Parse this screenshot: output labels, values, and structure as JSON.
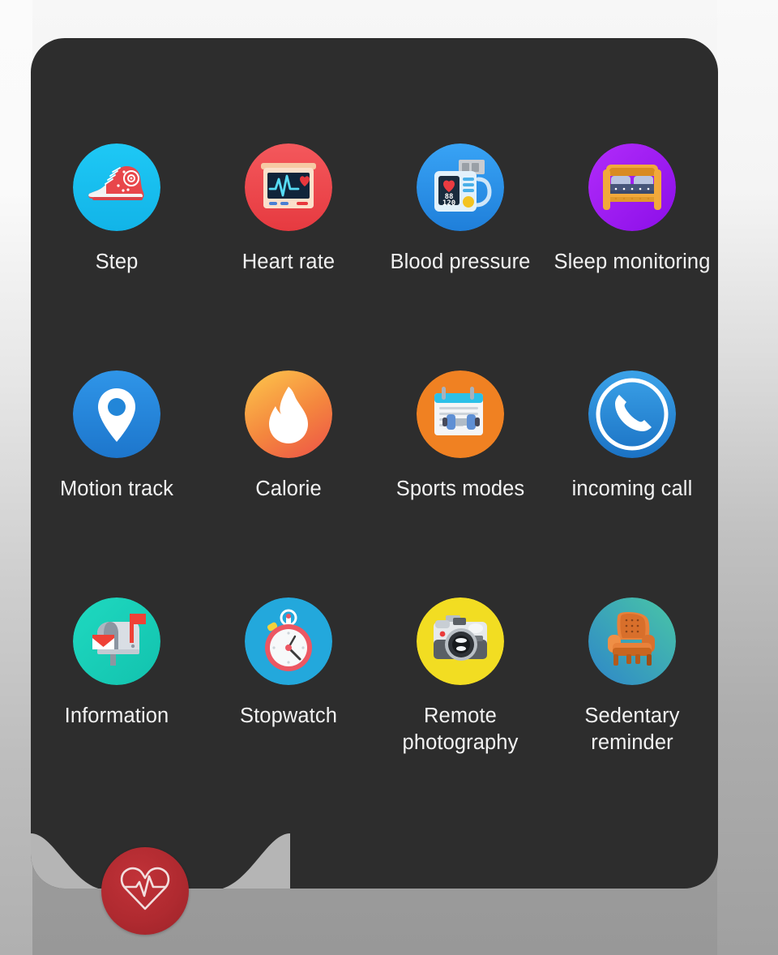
{
  "device": {
    "screen_background": "#2d2d2d",
    "backdrop_top_color": "#f7f7f7",
    "backdrop_bottom_color": "#989898"
  },
  "home_button": {
    "icon": "heart-pulse-icon",
    "color": "#b02a30",
    "label": ""
  },
  "grid": {
    "columns": 4,
    "items": [
      {
        "label": "Step",
        "icon": "sneaker-icon",
        "disc_color": "#17c3f0",
        "row": 1,
        "col": 1
      },
      {
        "label": "Heart rate",
        "icon": "heart-monitor-icon",
        "disc_color": "#f0484c",
        "row": 1,
        "col": 2
      },
      {
        "label": "Blood pressure",
        "icon": "blood-pressure-monitor-icon",
        "disc_color": "#2b93ec",
        "reading_systolic": "88",
        "reading_diastolic": "120",
        "row": 1,
        "col": 3
      },
      {
        "label": "Sleep monitoring",
        "icon": "bed-icon",
        "disc_color": "#a21cf5",
        "row": 1,
        "col": 4
      },
      {
        "label": "Motion track",
        "icon": "map-pin-icon",
        "disc_color": "#2286d8",
        "row": 2,
        "col": 1
      },
      {
        "label": "Calorie",
        "icon": "flame-icon",
        "disc_color": "#f47b42",
        "row": 2,
        "col": 2
      },
      {
        "label": "Sports modes",
        "icon": "calendar-dumbbell-icon",
        "disc_color": "#f08122",
        "row": 2,
        "col": 3
      },
      {
        "label": "incoming call",
        "icon": "phone-handset-icon",
        "disc_color": "#2b8fd8",
        "row": 2,
        "col": 4
      },
      {
        "label": "Information",
        "icon": "mailbox-icon",
        "disc_color": "#1bd2bb",
        "row": 3,
        "col": 1
      },
      {
        "label": "Stopwatch",
        "icon": "stopwatch-icon",
        "disc_color": "#23a8dc",
        "row": 3,
        "col": 2
      },
      {
        "label": "Remote photography",
        "icon": "camera-icon",
        "disc_color": "#f2dd22",
        "row": 3,
        "col": 3
      },
      {
        "label": "Sedentary reminder",
        "icon": "armchair-icon",
        "disc_color": "#3fa9a0",
        "row": 3,
        "col": 4
      }
    ]
  }
}
